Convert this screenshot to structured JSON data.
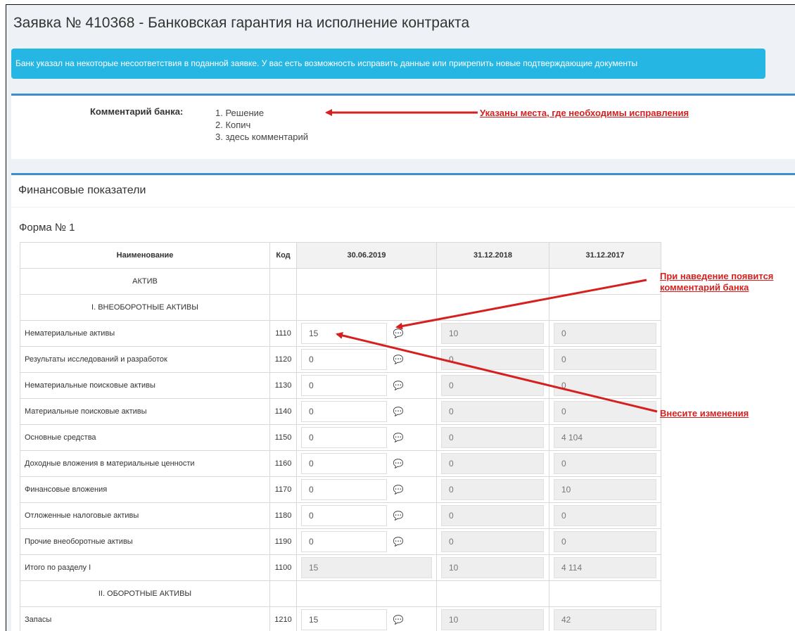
{
  "page_title": "Заявка № 410368 - Банковская гарантия на исполнение контракта",
  "alert_text": "Банк указал на некоторые несоответствия в поданной заявке. У вас есть возможность исправить данные или прикрепить новые подтверждающие документы",
  "comment": {
    "label": "Комментарий банка:",
    "items": [
      "1. Решение",
      "2. Копич",
      "3. здесь комментарий"
    ]
  },
  "financial": {
    "title": "Финансовые показатели",
    "form_title": "Форма № 1",
    "headers": {
      "name": "Наименование",
      "code": "Код",
      "p1": "30.06.2019",
      "p2": "31.12.2018",
      "p3": "31.12.2017"
    },
    "sections": {
      "aktiv": "АКТИВ",
      "s1": "I. ВНЕОБОРОТНЫЕ АКТИВЫ",
      "s2": "II. ОБОРОТНЫЕ АКТИВЫ"
    },
    "rows": [
      {
        "name": "Нематериальные активы",
        "code": "1110",
        "v1": "15",
        "v2": "10",
        "v3": "0"
      },
      {
        "name": "Результаты исследований и разработок",
        "code": "1120",
        "v1": "0",
        "v2": "0",
        "v3": "0"
      },
      {
        "name": "Нематериальные поисковые активы",
        "code": "1130",
        "v1": "0",
        "v2": "0",
        "v3": "0"
      },
      {
        "name": "Материальные поисковые активы",
        "code": "1140",
        "v1": "0",
        "v2": "0",
        "v3": "0"
      },
      {
        "name": "Основные средства",
        "code": "1150",
        "v1": "0",
        "v2": "0",
        "v3": "4 104"
      },
      {
        "name": "Доходные вложения в материальные ценности",
        "code": "1160",
        "v1": "0",
        "v2": "0",
        "v3": "0"
      },
      {
        "name": "Финансовые вложения",
        "code": "1170",
        "v1": "0",
        "v2": "0",
        "v3": "10"
      },
      {
        "name": "Отложенные налоговые активы",
        "code": "1180",
        "v1": "0",
        "v2": "0",
        "v3": "0"
      },
      {
        "name": "Прочие внеоборотные активы",
        "code": "1190",
        "v1": "0",
        "v2": "0",
        "v3": "0"
      }
    ],
    "total": {
      "name": "Итого по разделу I",
      "code": "1100",
      "v1": "15",
      "v2": "10",
      "v3": "4 114"
    },
    "row_zapasy": {
      "name": "Запасы",
      "code": "1210",
      "v1": "15",
      "v2": "10",
      "v3": "42"
    }
  },
  "annotations": {
    "corrections": "Указаны места, где необходимы исправления",
    "hover_line1": "При наведение появится",
    "hover_line2": "комментарий банка",
    "make_changes": "Внесите изменения"
  },
  "colors": {
    "alert_bg": "#26b6e4",
    "panel_border": "#3b8fcf",
    "annotation": "#d61f1f"
  },
  "icons": {
    "comment": "comment-bubble-icon"
  }
}
